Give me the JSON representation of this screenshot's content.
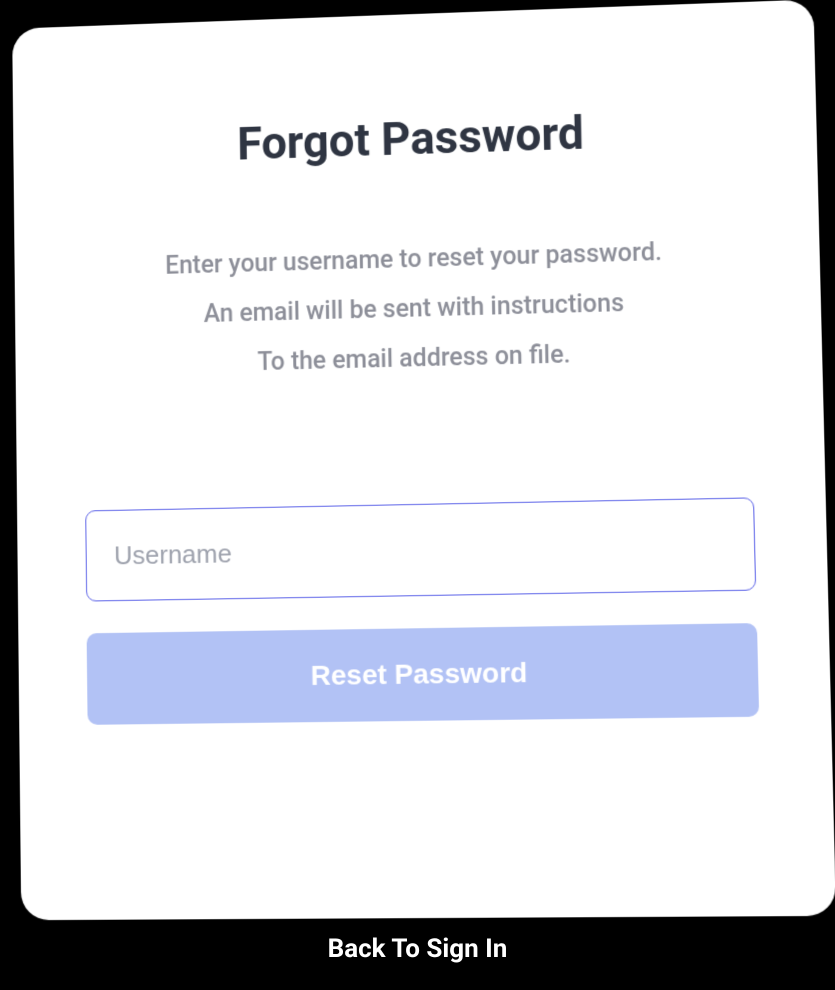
{
  "card": {
    "title": "Forgot Password",
    "description_line1": "Enter your username to reset your password.",
    "description_line2": "An email will be sent with instructions",
    "description_line3": "To the email address on file.",
    "username_placeholder": "Username",
    "reset_button_label": "Reset Password"
  },
  "footer": {
    "back_link_label": "Back To Sign In"
  },
  "colors": {
    "primary_border": "#5c63e8",
    "button_bg": "#b2c2f5",
    "title_color": "#2f3542",
    "muted_text": "#8d8f99"
  }
}
